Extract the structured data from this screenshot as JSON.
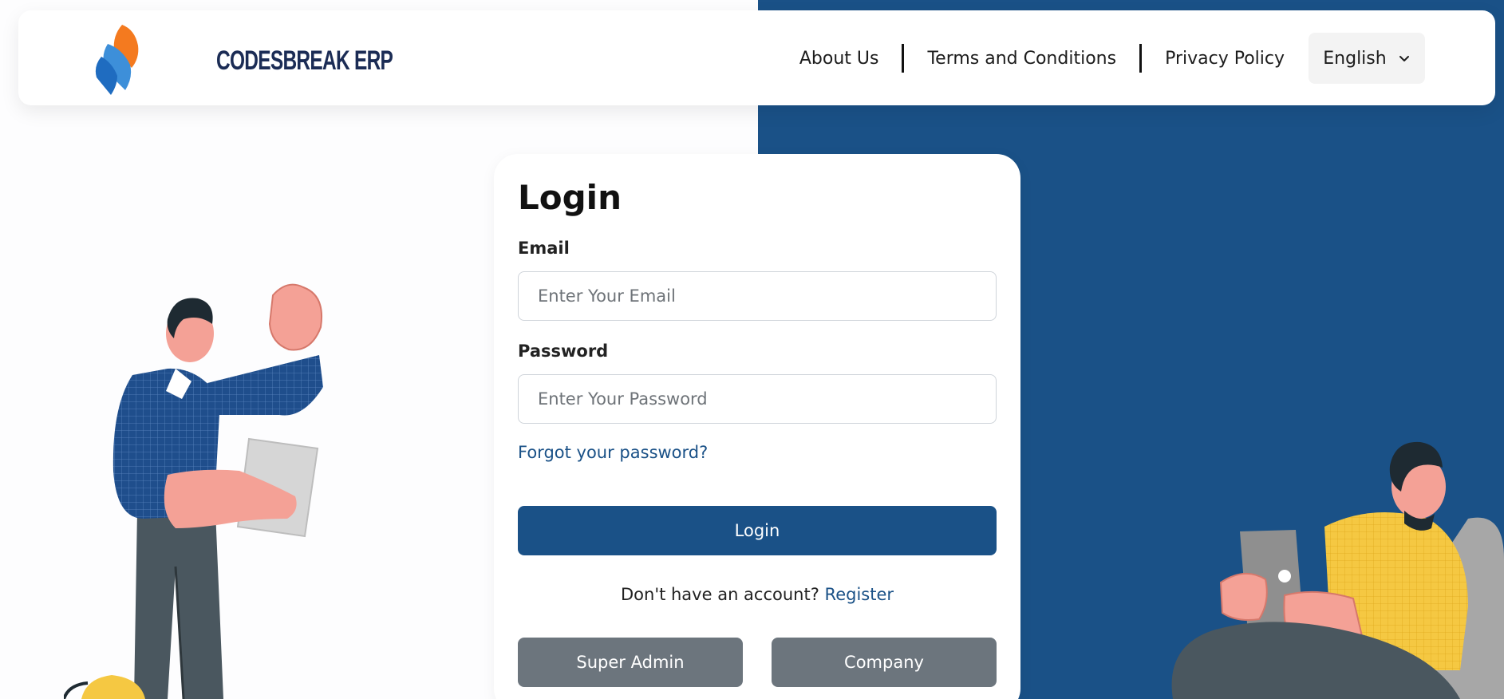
{
  "brand": {
    "logo_text": "CODESBREAK ERP"
  },
  "nav": {
    "about": "About Us",
    "terms": "Terms and Conditions",
    "privacy": "Privacy Policy",
    "language": "English"
  },
  "login": {
    "title": "Login",
    "email_label": "Email",
    "email_placeholder": "Enter Your Email",
    "password_label": "Password",
    "password_placeholder": "Enter Your Password",
    "forgot": "Forgot your password?",
    "submit": "Login",
    "no_account": "Don't have an account?",
    "register": "Register",
    "super_admin": "Super Admin",
    "company": "Company"
  },
  "colors": {
    "primary": "#1a5187",
    "secondary_button": "#6c757d",
    "logo_text": "#1b2c55"
  },
  "icons": {
    "language_dropdown": "chevron-down-icon"
  }
}
